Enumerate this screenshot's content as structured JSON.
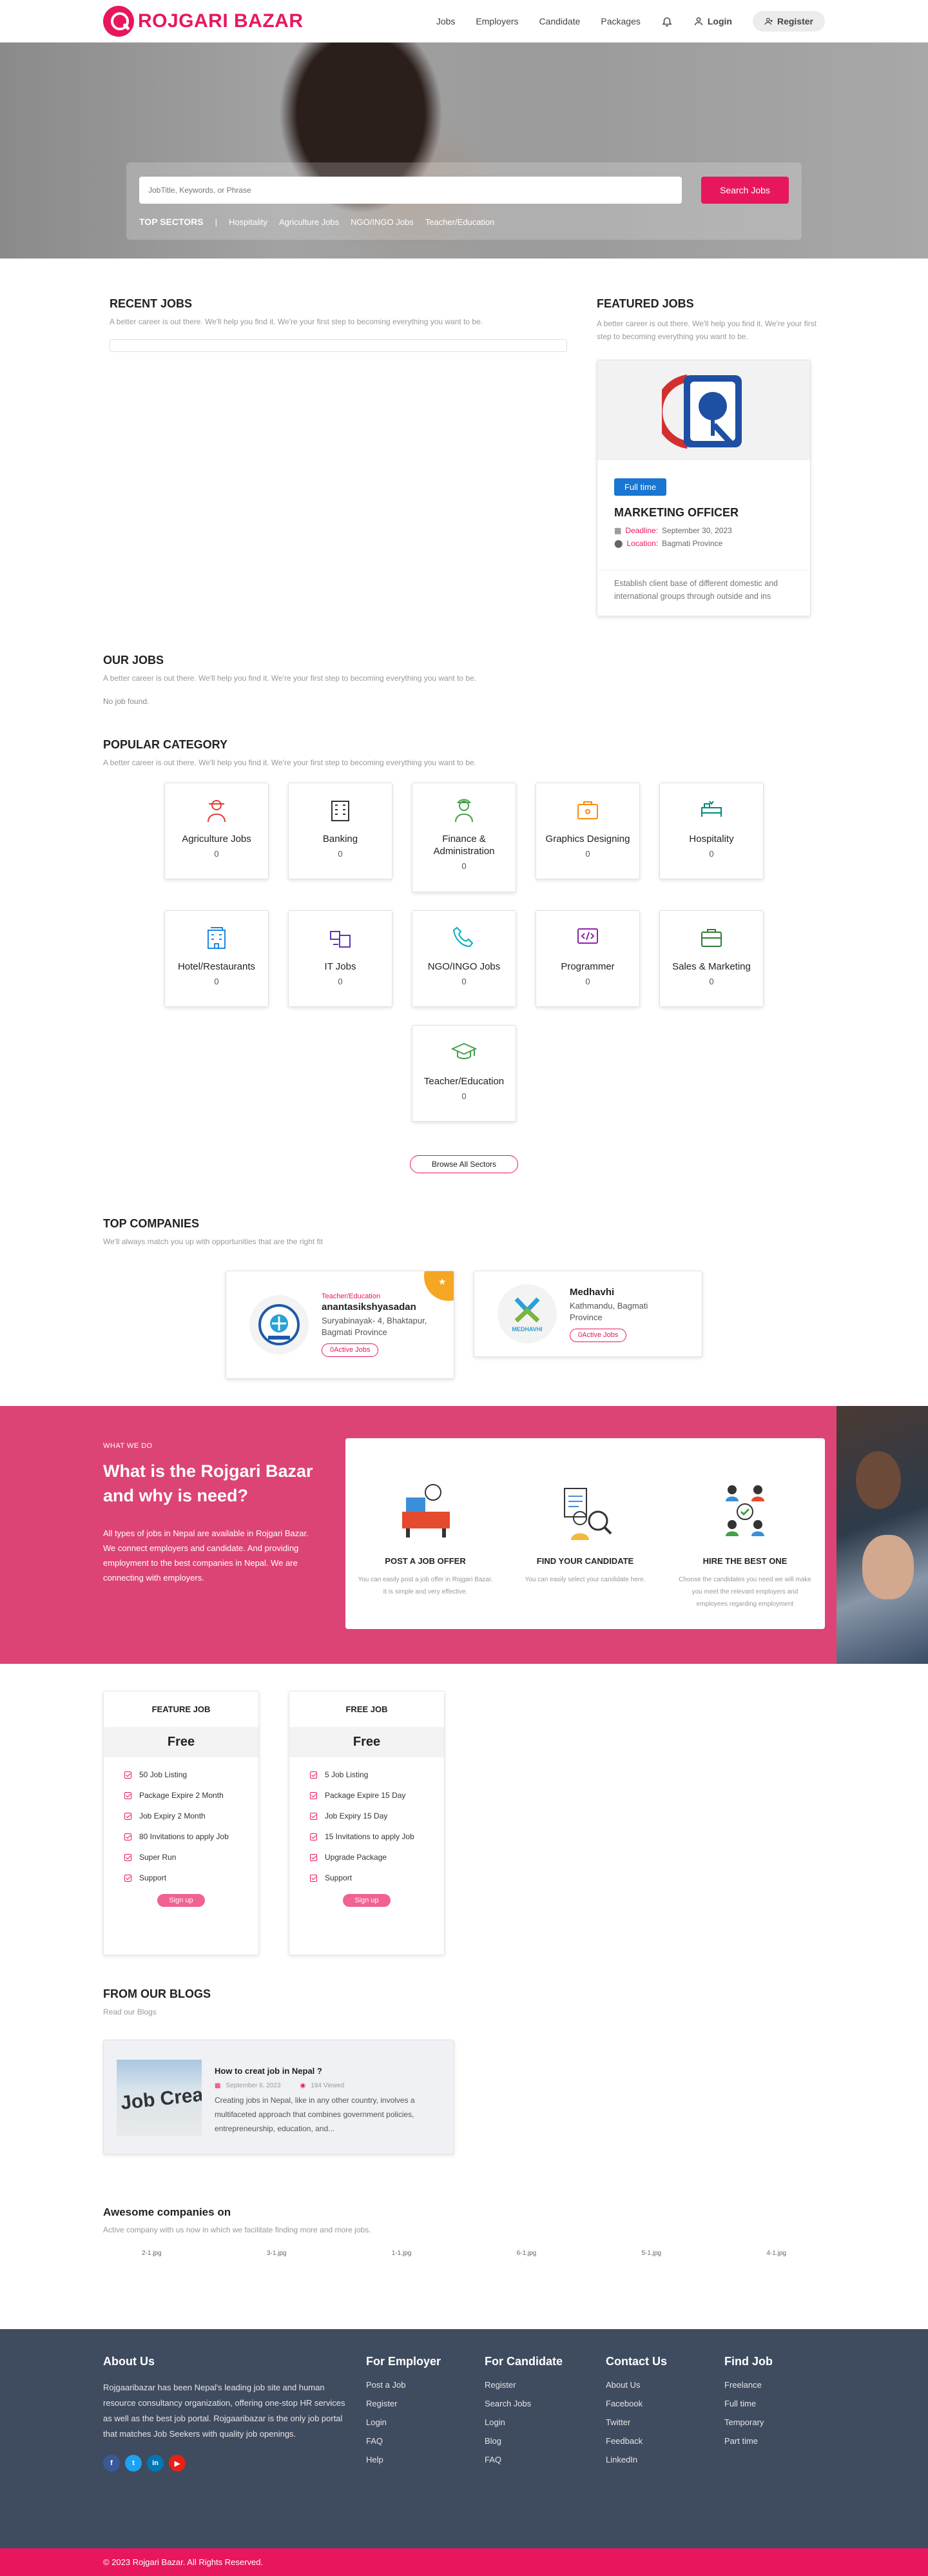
{
  "brand": {
    "name": "ROJGARI BAZAR"
  },
  "nav": {
    "items": [
      "Jobs",
      "Employers",
      "Candidate",
      "Packages"
    ],
    "login": "Login",
    "register": "Register"
  },
  "search": {
    "placeholder": "JobTitle, Keywords, or Phrase",
    "button": "Search Jobs",
    "sectors_label": "TOP SECTORS",
    "sectors": [
      "Hospitality",
      "Agriculture Jobs",
      "NGO/INGO Jobs",
      "Teacher/Education"
    ]
  },
  "recent": {
    "title": "RECENT JOBS",
    "subtitle": "A better career is out there. We'll help you find it. We're your first step to becoming everything you want to be."
  },
  "featured": {
    "title": "FEATURED JOBS",
    "subtitle": "A better career is out there. We'll help you find it. We're your first step to becoming everything you want to be.",
    "job": {
      "type": "Full time",
      "title": "MARKETING OFFICER",
      "deadline_label": "Deadline:",
      "deadline": "September 30, 2023",
      "location_label": "Location:",
      "location": "Bagmati Province",
      "description": "Establish client base of different domestic and international groups through outside and ins"
    }
  },
  "ourjobs": {
    "title": "OUR JOBS",
    "subtitle": "A better career is out there. We'll help you find it. We're your first step to becoming everything you want to be.",
    "empty": "No job found."
  },
  "popular": {
    "title": "POPULAR CATEGORY",
    "subtitle": "A better career is out there. We'll help you find it. We're your first step to becoming everything you want to be.",
    "categories": [
      {
        "name": "Agriculture Jobs",
        "count": "0",
        "color": "#e53935"
      },
      {
        "name": "Banking",
        "count": "0",
        "color": "#333333"
      },
      {
        "name": "Finance & Administration",
        "count": "0",
        "color": "#43a047"
      },
      {
        "name": "Graphics Designing",
        "count": "0",
        "color": "#fb8c00"
      },
      {
        "name": "Hospitality",
        "count": "0",
        "color": "#00897b"
      },
      {
        "name": "Hotel/Restaurants",
        "count": "0",
        "color": "#1e88e5"
      },
      {
        "name": "IT Jobs",
        "count": "0",
        "color": "#5e35b1"
      },
      {
        "name": "NGO/INGO Jobs",
        "count": "0",
        "color": "#00acc1"
      },
      {
        "name": "Programmer",
        "count": "0",
        "color": "#8e24aa"
      },
      {
        "name": "Sales & Marketing",
        "count": "0",
        "color": "#2e7d32"
      },
      {
        "name": "Teacher/Education",
        "count": "0",
        "color": "#43a047"
      }
    ],
    "browse": "Browse All Sectors"
  },
  "companies": {
    "title": "TOP COMPANIES",
    "subtitle": "We'll always match you up with opportunities that are the right fit",
    "items": [
      {
        "tag": "Teacher/Education",
        "name": "anantasikshyasadan",
        "address": "Suryabinayak- 4, Bhaktapur, Bagmati Province",
        "active": "0Active Jobs"
      },
      {
        "tag": "",
        "name": "Medhavhi",
        "address": "Kathmandu, Bagmati Province",
        "active": "0Active Jobs",
        "logo_text": "MEDHAVHI"
      }
    ]
  },
  "wwd": {
    "kicker": "WHAT WE DO",
    "title": "What is the Rojgari Bazar and why is need?",
    "text": "All types of jobs in Nepal are available in Rojgari Bazar. We connect employers and candidate. And providing employment to the best companies in Nepal. We are connecting with employers.",
    "steps": [
      {
        "title": "POST A JOB OFFER",
        "text": "You can easily post a job offer in Rojgari Bazar. It is simple and very effective."
      },
      {
        "title": "FIND YOUR CANDIDATE",
        "text": "You can easily select your candidate here."
      },
      {
        "title": "HIRE THE BEST ONE",
        "text": "Choose the candidates you need we will make you meet the relevant employers and employees regarding employment"
      }
    ]
  },
  "packages": [
    {
      "title": "FEATURE JOB",
      "price": "Free",
      "features": [
        "50 Job Listing",
        "Package Expire 2 Month",
        "Job Expiry 2 Month",
        "80 Invitations to apply Job",
        "Super Run",
        "Support"
      ],
      "cta": "Sign up"
    },
    {
      "title": "FREE JOB",
      "price": "Free",
      "features": [
        "5 Job Listing",
        "Package Expire 15 Day",
        "Job Expiry 15 Day",
        "15 Invitations to apply Job",
        "Upgrade Package",
        "Support"
      ],
      "cta": "Sign up"
    }
  ],
  "blogs": {
    "title": "FROM OUR BLOGS",
    "subtitle": "Read our Blogs",
    "post": {
      "image_text": "Job Creat",
      "title": "How to creat job in Nepal ?",
      "date": "September 6, 2023",
      "views": "194 Viewed",
      "excerpt": "Creating jobs in Nepal, like in any other country, involves a multifaceted approach that combines government policies, entrepreneurship, education, and..."
    }
  },
  "awesome": {
    "title": "Awesome companies on",
    "subtitle": "Active company with us now in which we facilitate finding more and more jobs.",
    "logos": [
      "2-1.jpg",
      "3-1.jpg",
      "1-1.jpg",
      "6-1.jpg",
      "5-1.jpg",
      "4-1.jpg"
    ]
  },
  "footer": {
    "about_title": "About Us",
    "about_text": "Rojgaaribazar has been Nepal's leading job site and human resource consultancy organization, offering one-stop HR services as well as the best job portal. Rojgaaribazar is the only job portal that matches Job Seekers with quality job openings.",
    "employer_title": "For Employer",
    "employer_links": [
      "Post a Job",
      "Register",
      "Login",
      "FAQ",
      "Help"
    ],
    "candidate_title": "For Candidate",
    "candidate_links": [
      "Register",
      "Search Jobs",
      "Login",
      "Blog",
      "FAQ"
    ],
    "contact_title": "Contact Us",
    "contact_links": [
      "About Us",
      "Facebook",
      "Twitter",
      "Feedback",
      "LinkedIn"
    ],
    "find_title": "Find Job",
    "find_links": [
      "Freelance",
      "Full time",
      "Temporary",
      "Part time"
    ],
    "social": [
      {
        "label": "f",
        "color": "#3b5998"
      },
      {
        "label": "t",
        "color": "#1da1f2"
      },
      {
        "label": "in",
        "color": "#0077b5"
      },
      {
        "label": "▶",
        "color": "#e62117"
      }
    ],
    "copyright": "© 2023 Rojgari Bazar. All Rights Reserved."
  },
  "colors": {
    "brand": "#e8175d",
    "wwd_bg": "#dd4476",
    "footer_bg": "#3f4b5f"
  }
}
